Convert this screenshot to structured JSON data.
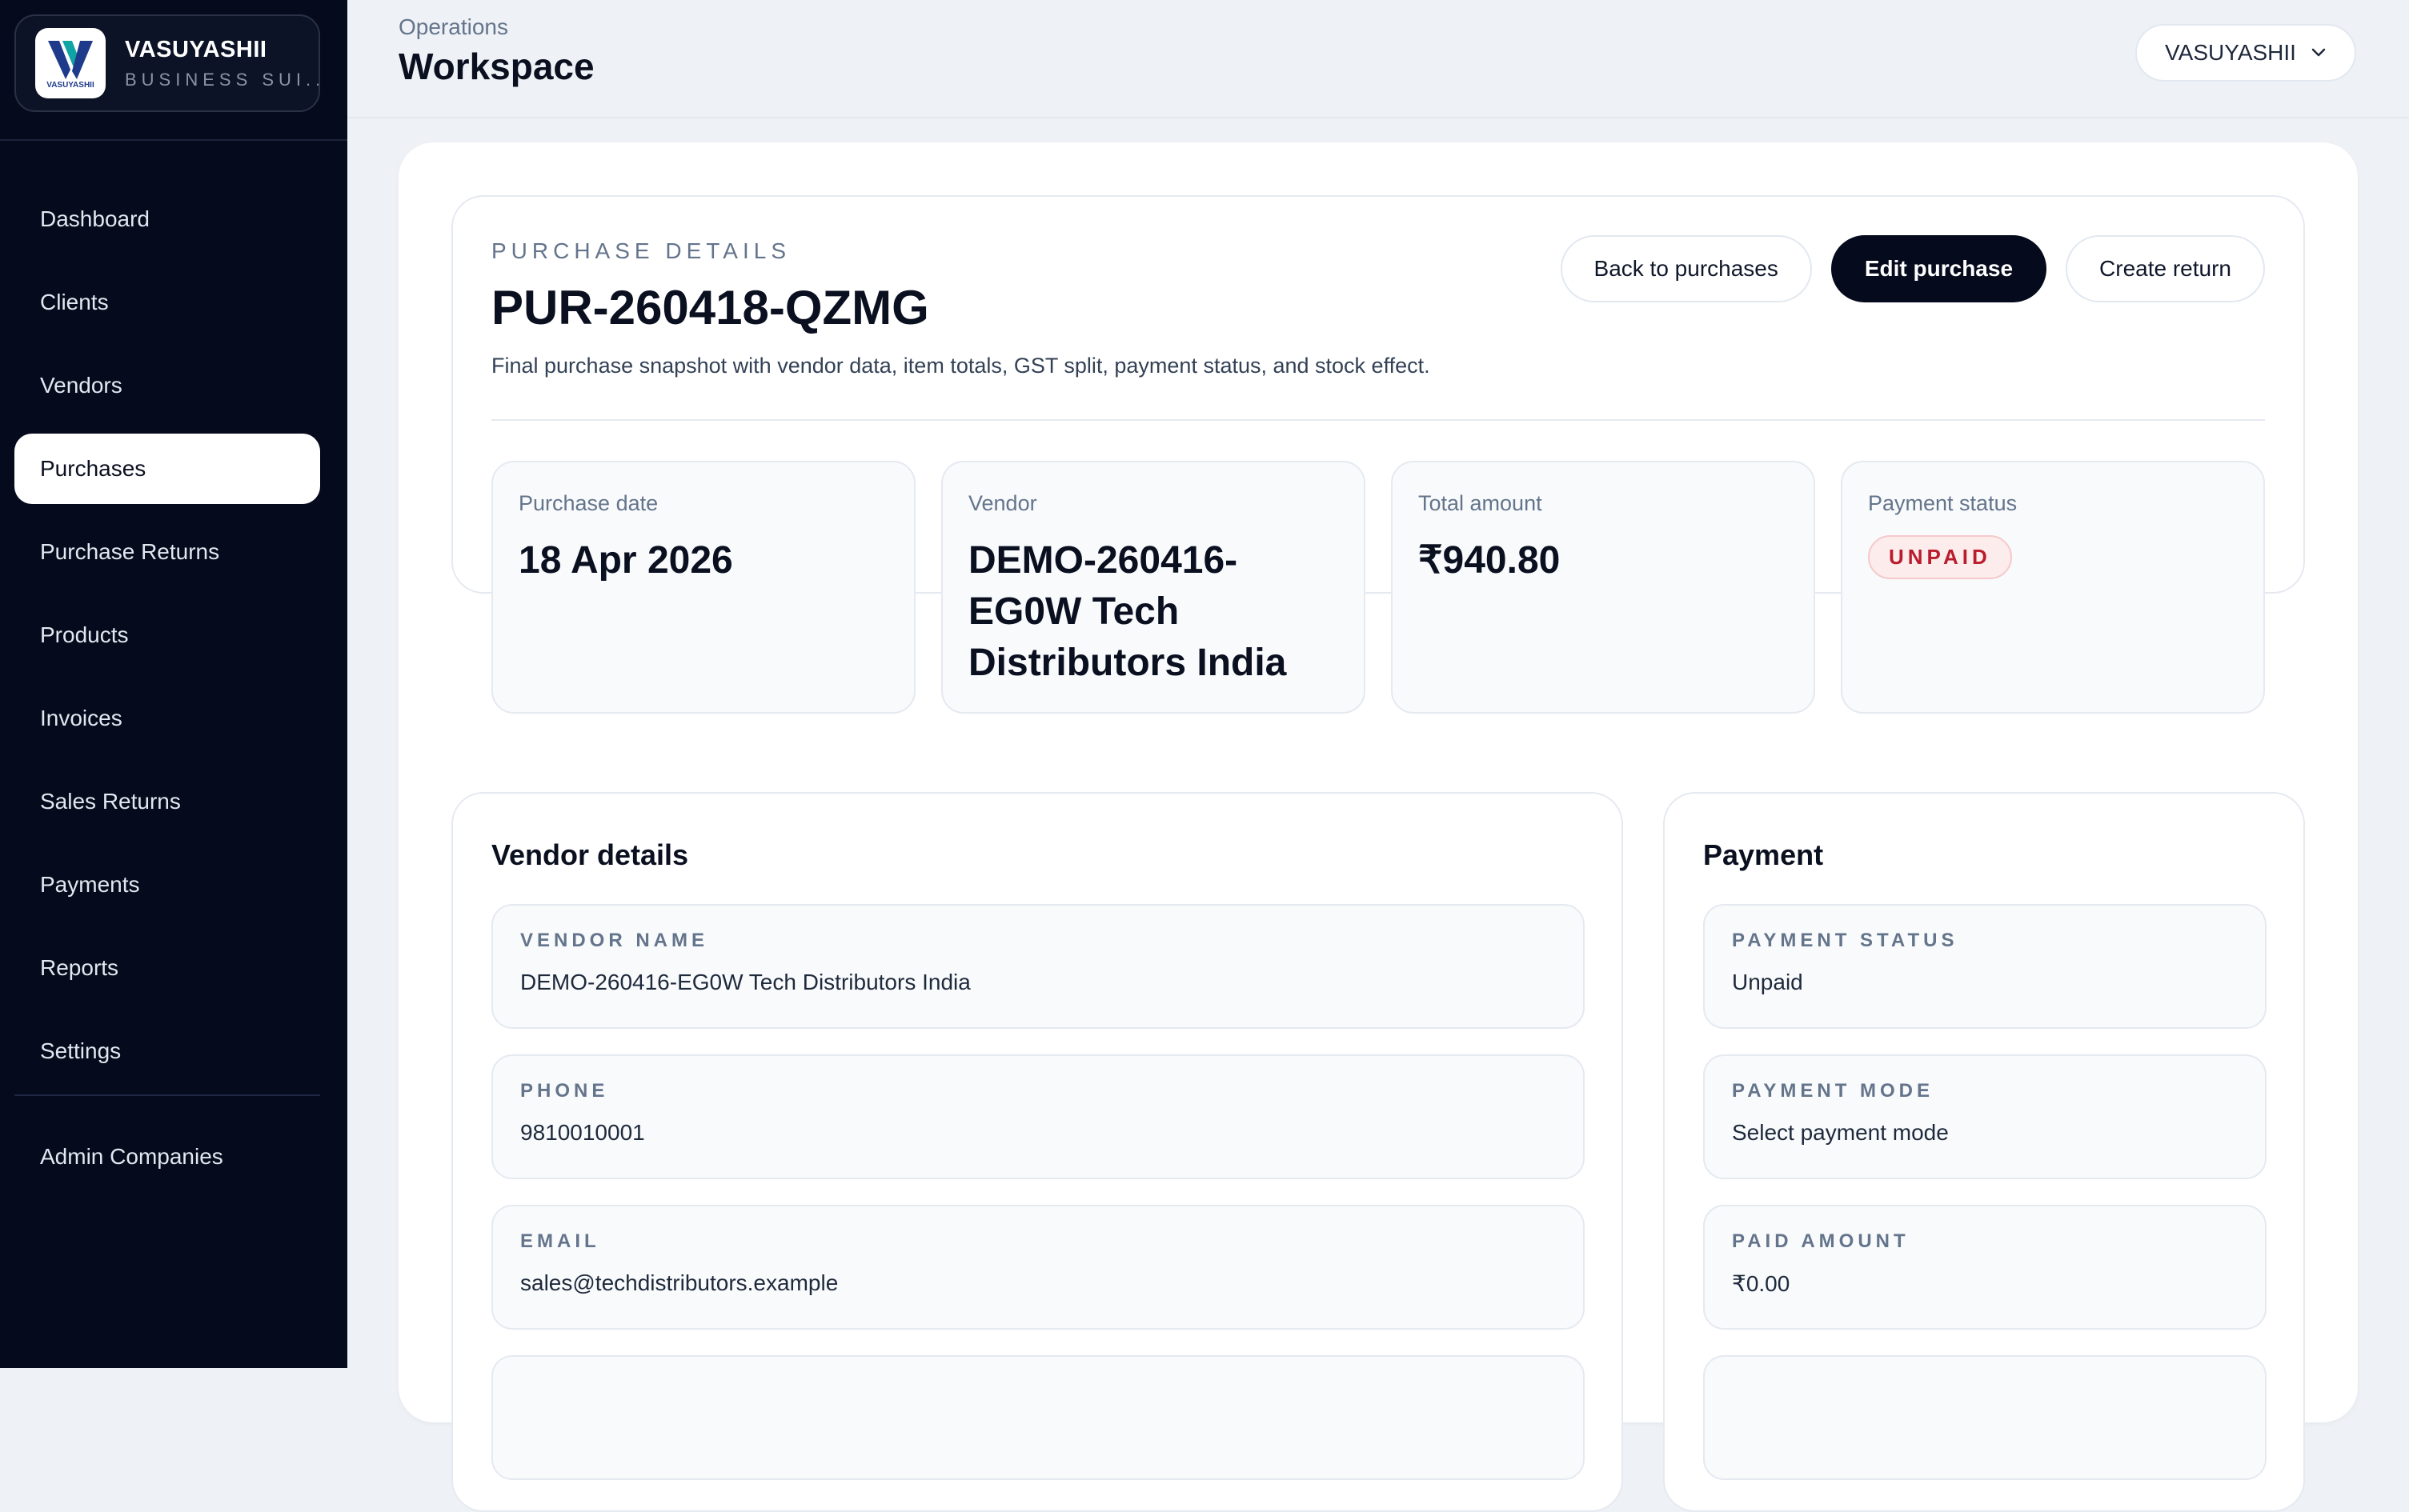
{
  "brand": {
    "name": "VASUYASHII",
    "subtitle": "BUSINESS SUI...",
    "logo_caption": "VASUYASHII"
  },
  "nav": {
    "items": [
      {
        "label": "Dashboard"
      },
      {
        "label": "Clients"
      },
      {
        "label": "Vendors"
      },
      {
        "label": "Purchases",
        "active": true
      },
      {
        "label": "Purchase Returns"
      },
      {
        "label": "Products"
      },
      {
        "label": "Invoices"
      },
      {
        "label": "Sales Returns"
      },
      {
        "label": "Payments"
      },
      {
        "label": "Reports"
      },
      {
        "label": "Settings"
      }
    ],
    "admin": "Admin Companies"
  },
  "header": {
    "breadcrumb": "Operations",
    "title": "Workspace",
    "company": "VASUYASHII"
  },
  "purchase": {
    "eyebrow": "PURCHASE DETAILS",
    "id": "PUR-260418-QZMG",
    "description": "Final purchase snapshot with vendor data, item totals, GST split, payment status, and stock effect.",
    "actions": {
      "back": "Back to purchases",
      "edit": "Edit purchase",
      "return": "Create return"
    },
    "stats": {
      "date": {
        "label": "Purchase date",
        "value": "18 Apr 2026"
      },
      "vendor": {
        "label": "Vendor",
        "value": "DEMO-260416-EG0W Tech Distributors India"
      },
      "total": {
        "label": "Total amount",
        "value": "₹940.80"
      },
      "status": {
        "label": "Payment status",
        "value": "UNPAID"
      }
    }
  },
  "vendor_details": {
    "title": "Vendor details",
    "fields": [
      {
        "label": "VENDOR NAME",
        "value": "DEMO-260416-EG0W Tech Distributors India"
      },
      {
        "label": "PHONE",
        "value": "9810010001"
      },
      {
        "label": "EMAIL",
        "value": "sales@techdistributors.example"
      }
    ]
  },
  "payment": {
    "title": "Payment",
    "fields": [
      {
        "label": "PAYMENT STATUS",
        "value": "Unpaid"
      },
      {
        "label": "PAYMENT MODE",
        "value": "Select payment mode"
      },
      {
        "label": "PAID AMOUNT",
        "value": "₹0.00"
      }
    ]
  },
  "colors": {
    "sidebar": "#050a1c",
    "accent": "#050a1c",
    "unpaid": "#b91c2c",
    "logo_blue": "#1e3a8a",
    "logo_teal": "#0ea5a4"
  }
}
